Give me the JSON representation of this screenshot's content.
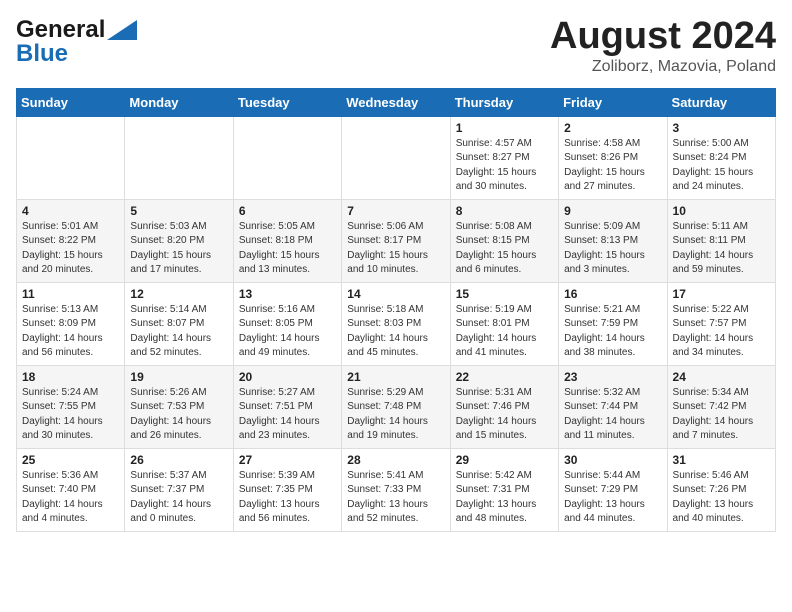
{
  "header": {
    "logo_line1": "General",
    "logo_line2": "Blue",
    "month_title": "August 2024",
    "location": "Zoliborz, Mazovia, Poland"
  },
  "weekdays": [
    "Sunday",
    "Monday",
    "Tuesday",
    "Wednesday",
    "Thursday",
    "Friday",
    "Saturday"
  ],
  "weeks": [
    [
      {
        "day": "",
        "info": ""
      },
      {
        "day": "",
        "info": ""
      },
      {
        "day": "",
        "info": ""
      },
      {
        "day": "",
        "info": ""
      },
      {
        "day": "1",
        "info": "Sunrise: 4:57 AM\nSunset: 8:27 PM\nDaylight: 15 hours\nand 30 minutes."
      },
      {
        "day": "2",
        "info": "Sunrise: 4:58 AM\nSunset: 8:26 PM\nDaylight: 15 hours\nand 27 minutes."
      },
      {
        "day": "3",
        "info": "Sunrise: 5:00 AM\nSunset: 8:24 PM\nDaylight: 15 hours\nand 24 minutes."
      }
    ],
    [
      {
        "day": "4",
        "info": "Sunrise: 5:01 AM\nSunset: 8:22 PM\nDaylight: 15 hours\nand 20 minutes."
      },
      {
        "day": "5",
        "info": "Sunrise: 5:03 AM\nSunset: 8:20 PM\nDaylight: 15 hours\nand 17 minutes."
      },
      {
        "day": "6",
        "info": "Sunrise: 5:05 AM\nSunset: 8:18 PM\nDaylight: 15 hours\nand 13 minutes."
      },
      {
        "day": "7",
        "info": "Sunrise: 5:06 AM\nSunset: 8:17 PM\nDaylight: 15 hours\nand 10 minutes."
      },
      {
        "day": "8",
        "info": "Sunrise: 5:08 AM\nSunset: 8:15 PM\nDaylight: 15 hours\nand 6 minutes."
      },
      {
        "day": "9",
        "info": "Sunrise: 5:09 AM\nSunset: 8:13 PM\nDaylight: 15 hours\nand 3 minutes."
      },
      {
        "day": "10",
        "info": "Sunrise: 5:11 AM\nSunset: 8:11 PM\nDaylight: 14 hours\nand 59 minutes."
      }
    ],
    [
      {
        "day": "11",
        "info": "Sunrise: 5:13 AM\nSunset: 8:09 PM\nDaylight: 14 hours\nand 56 minutes."
      },
      {
        "day": "12",
        "info": "Sunrise: 5:14 AM\nSunset: 8:07 PM\nDaylight: 14 hours\nand 52 minutes."
      },
      {
        "day": "13",
        "info": "Sunrise: 5:16 AM\nSunset: 8:05 PM\nDaylight: 14 hours\nand 49 minutes."
      },
      {
        "day": "14",
        "info": "Sunrise: 5:18 AM\nSunset: 8:03 PM\nDaylight: 14 hours\nand 45 minutes."
      },
      {
        "day": "15",
        "info": "Sunrise: 5:19 AM\nSunset: 8:01 PM\nDaylight: 14 hours\nand 41 minutes."
      },
      {
        "day": "16",
        "info": "Sunrise: 5:21 AM\nSunset: 7:59 PM\nDaylight: 14 hours\nand 38 minutes."
      },
      {
        "day": "17",
        "info": "Sunrise: 5:22 AM\nSunset: 7:57 PM\nDaylight: 14 hours\nand 34 minutes."
      }
    ],
    [
      {
        "day": "18",
        "info": "Sunrise: 5:24 AM\nSunset: 7:55 PM\nDaylight: 14 hours\nand 30 minutes."
      },
      {
        "day": "19",
        "info": "Sunrise: 5:26 AM\nSunset: 7:53 PM\nDaylight: 14 hours\nand 26 minutes."
      },
      {
        "day": "20",
        "info": "Sunrise: 5:27 AM\nSunset: 7:51 PM\nDaylight: 14 hours\nand 23 minutes."
      },
      {
        "day": "21",
        "info": "Sunrise: 5:29 AM\nSunset: 7:48 PM\nDaylight: 14 hours\nand 19 minutes."
      },
      {
        "day": "22",
        "info": "Sunrise: 5:31 AM\nSunset: 7:46 PM\nDaylight: 14 hours\nand 15 minutes."
      },
      {
        "day": "23",
        "info": "Sunrise: 5:32 AM\nSunset: 7:44 PM\nDaylight: 14 hours\nand 11 minutes."
      },
      {
        "day": "24",
        "info": "Sunrise: 5:34 AM\nSunset: 7:42 PM\nDaylight: 14 hours\nand 7 minutes."
      }
    ],
    [
      {
        "day": "25",
        "info": "Sunrise: 5:36 AM\nSunset: 7:40 PM\nDaylight: 14 hours\nand 4 minutes."
      },
      {
        "day": "26",
        "info": "Sunrise: 5:37 AM\nSunset: 7:37 PM\nDaylight: 14 hours\nand 0 minutes."
      },
      {
        "day": "27",
        "info": "Sunrise: 5:39 AM\nSunset: 7:35 PM\nDaylight: 13 hours\nand 56 minutes."
      },
      {
        "day": "28",
        "info": "Sunrise: 5:41 AM\nSunset: 7:33 PM\nDaylight: 13 hours\nand 52 minutes."
      },
      {
        "day": "29",
        "info": "Sunrise: 5:42 AM\nSunset: 7:31 PM\nDaylight: 13 hours\nand 48 minutes."
      },
      {
        "day": "30",
        "info": "Sunrise: 5:44 AM\nSunset: 7:29 PM\nDaylight: 13 hours\nand 44 minutes."
      },
      {
        "day": "31",
        "info": "Sunrise: 5:46 AM\nSunset: 7:26 PM\nDaylight: 13 hours\nand 40 minutes."
      }
    ]
  ]
}
